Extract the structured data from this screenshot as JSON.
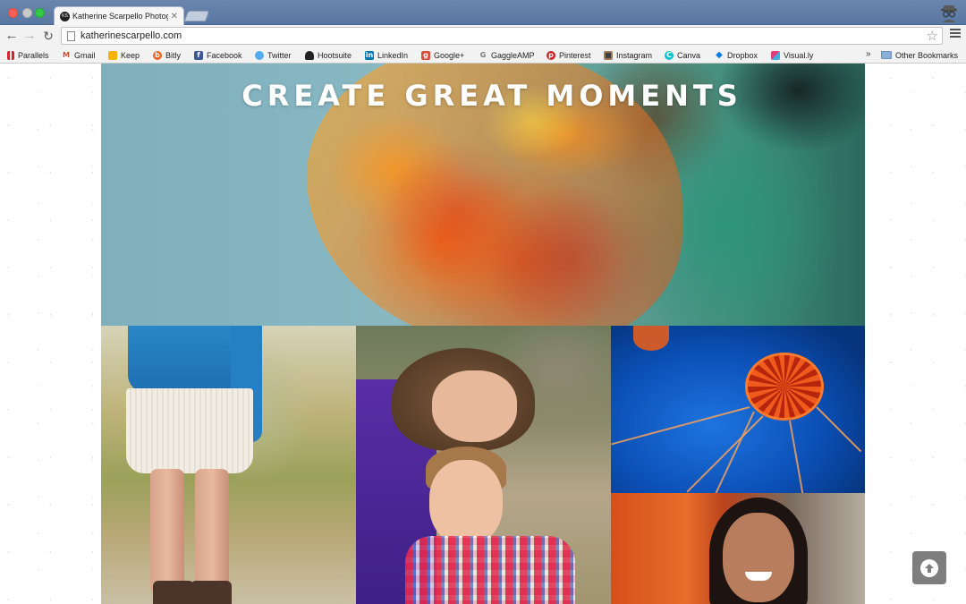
{
  "browser": {
    "tab_title": "Katherine Scarpello Photography",
    "tab_favicon_text": "KS",
    "url": "katherinescarpello.com",
    "bookmarks": [
      {
        "label": "Parallels",
        "icon": "parallels-icon",
        "color": "#d0282e"
      },
      {
        "label": "Gmail",
        "icon": "gmail-icon",
        "color": "#d44638"
      },
      {
        "label": "Keep",
        "icon": "keep-icon",
        "color": "#f6b400"
      },
      {
        "label": "Bitly",
        "icon": "bitly-icon",
        "color": "#ee6123"
      },
      {
        "label": "Facebook",
        "icon": "facebook-icon",
        "color": "#3b5998"
      },
      {
        "label": "Twitter",
        "icon": "twitter-icon",
        "color": "#55acee"
      },
      {
        "label": "Hootsuite",
        "icon": "hootsuite-icon",
        "color": "#222222"
      },
      {
        "label": "LinkedIn",
        "icon": "linkedin-icon",
        "color": "#0077b5"
      },
      {
        "label": "Google+",
        "icon": "googleplus-icon",
        "color": "#dd4b39"
      },
      {
        "label": "GaggleAMP",
        "icon": "gaggleamp-icon",
        "color": "#777777"
      },
      {
        "label": "Pinterest",
        "icon": "pinterest-icon",
        "color": "#cb2027"
      },
      {
        "label": "Instagram",
        "icon": "instagram-icon",
        "color": "#3f3f3f"
      },
      {
        "label": "Canva",
        "icon": "canva-icon",
        "color": "#00c4cc"
      },
      {
        "label": "Dropbox",
        "icon": "dropbox-icon",
        "color": "#007ee5"
      },
      {
        "label": "Visual.ly",
        "icon": "visually-icon",
        "color": "#e23c79"
      }
    ],
    "overflow_label": "»",
    "other_bookmarks_label": "Other Bookmarks"
  },
  "hero": {
    "title": "CREATE GREAT MOMENTS"
  },
  "gallery": [
    {
      "name": "girl-in-skirt-photo"
    },
    {
      "name": "siblings-portrait-photo"
    },
    {
      "name": "jellyfish-photo"
    },
    {
      "name": "smiling-woman-photo"
    }
  ],
  "scroll_top": {
    "icon": "arrow-up-circle-icon"
  }
}
